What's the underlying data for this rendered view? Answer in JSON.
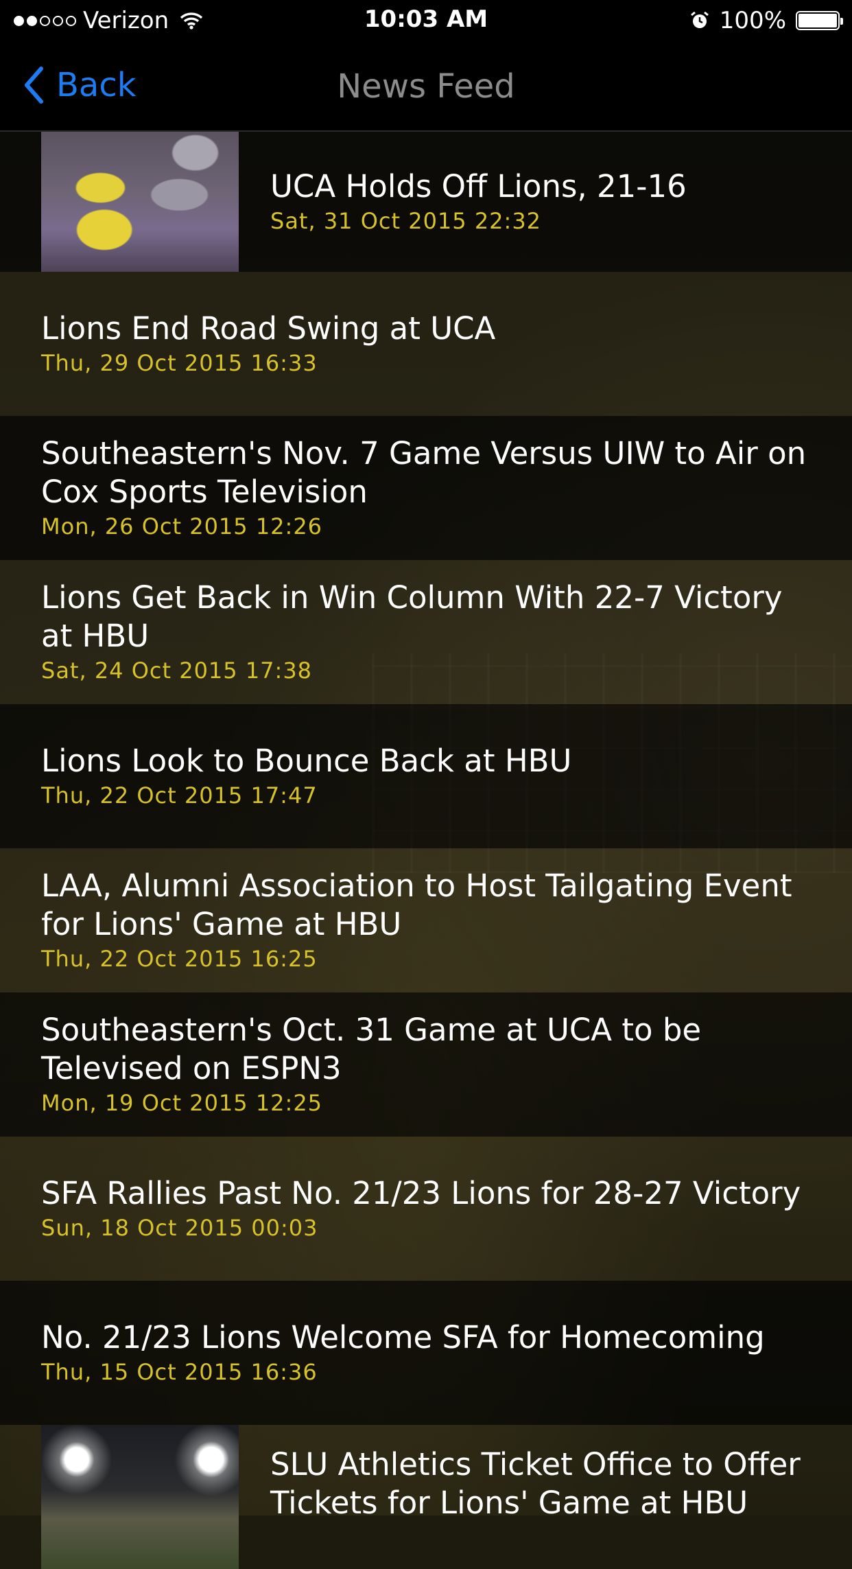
{
  "status_bar": {
    "carrier": "Verizon",
    "time": "10:03 AM",
    "battery": "100%",
    "signal_icon": "signal-dots-icon",
    "wifi_icon": "wifi-icon",
    "alarm_icon": "alarm-icon",
    "battery_icon": "battery-icon",
    "signal_strength": 2,
    "signal_max": 5
  },
  "nav": {
    "back_label": "Back",
    "title": "News Feed",
    "accent_color": "#1e7cf2"
  },
  "colors": {
    "date": "#d8c22a",
    "title": "#ffffff"
  },
  "items": [
    {
      "title": "UCA Holds Off Lions, 21-16",
      "date": "Sat, 31 Oct 2015 22:32",
      "thumbnail": "football-photo"
    },
    {
      "title": "Lions End Road Swing at UCA",
      "date": "Thu, 29 Oct 2015 16:33"
    },
    {
      "title": "Southeastern's Nov. 7 Game Versus UIW to Air on Cox Sports Television",
      "date": "Mon, 26 Oct 2015 12:26"
    },
    {
      "title": "Lions Get Back in Win Column With 22-7 Victory at HBU",
      "date": "Sat, 24 Oct 2015 17:38"
    },
    {
      "title": "Lions Look to Bounce Back at HBU",
      "date": "Thu, 22 Oct 2015 17:47"
    },
    {
      "title": "LAA, Alumni Association to Host Tailgating Event for Lions' Game at HBU",
      "date": "Thu, 22 Oct 2015 16:25"
    },
    {
      "title": "Southeastern's Oct. 31 Game at UCA to be Televised on ESPN3",
      "date": "Mon, 19 Oct 2015 12:25"
    },
    {
      "title": "SFA Rallies Past No. 21/23 Lions for 28-27 Victory",
      "date": "Sun, 18 Oct 2015 00:03"
    },
    {
      "title": "No. 21/23 Lions Welcome SFA for Homecoming",
      "date": "Thu, 15 Oct 2015 16:36"
    },
    {
      "title": "SLU Athletics Ticket Office to Offer Tickets for Lions' Game at HBU",
      "date": "",
      "thumbnail": "stadium-photo"
    }
  ]
}
